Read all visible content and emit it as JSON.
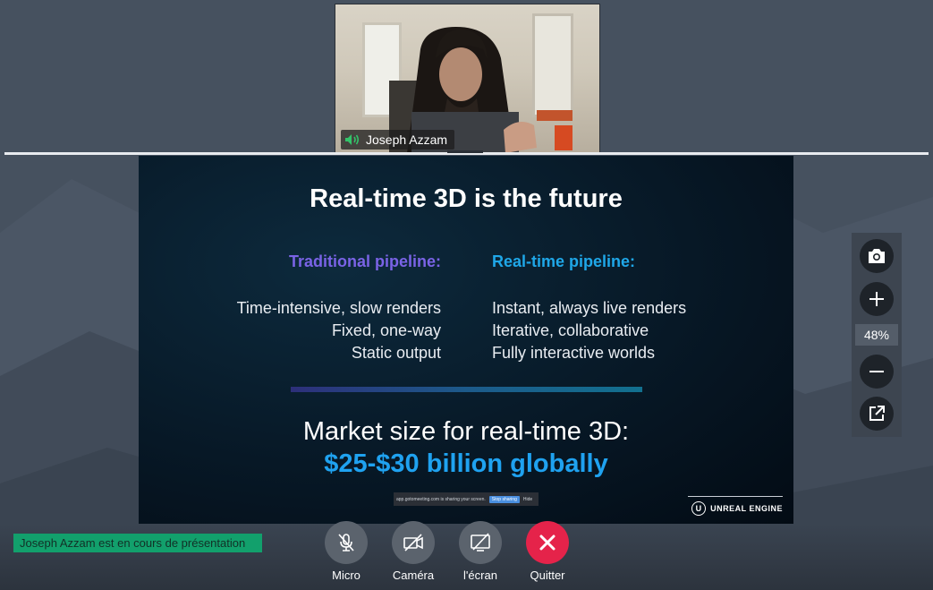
{
  "participant": {
    "name": "Joseph Azzam",
    "audio_icon": "speaker-active-icon"
  },
  "slide": {
    "title": "Real-time 3D is the future",
    "left_heading": "Traditional pipeline:",
    "right_heading": "Real-time pipeline:",
    "left_items": [
      "Time-intensive, slow renders",
      "Fixed, one-way",
      "Static output"
    ],
    "right_items": [
      "Instant, always live renders",
      "Iterative, collaborative",
      "Fully interactive worlds"
    ],
    "market_label": "Market size for real-time 3D:",
    "market_value": "$25-$30 billion globally",
    "share_notice": "app.gotomeeting.com is sharing your screen.",
    "share_stop": "Stop sharing",
    "share_hide": "Hide",
    "brand": "UNREAL ENGINE",
    "colors": {
      "left_heading": "#7a63e6",
      "right_heading": "#1fa7e8",
      "market_value": "#1fa2f0"
    }
  },
  "zoom": {
    "percent": "48%",
    "icons": [
      "camera-icon",
      "plus-icon",
      "minus-icon",
      "popout-icon"
    ]
  },
  "status": {
    "text": "Joseph Azzam est en cours de présentation",
    "color": "#12a06c"
  },
  "controls": [
    {
      "label": "Micro",
      "icon": "mic-off-icon"
    },
    {
      "label": "Caméra",
      "icon": "camera-off-icon"
    },
    {
      "label": "l'écran",
      "icon": "screen-share-off-icon"
    },
    {
      "label": "Quitter",
      "icon": "close-icon",
      "color": "#e5234a"
    }
  ]
}
